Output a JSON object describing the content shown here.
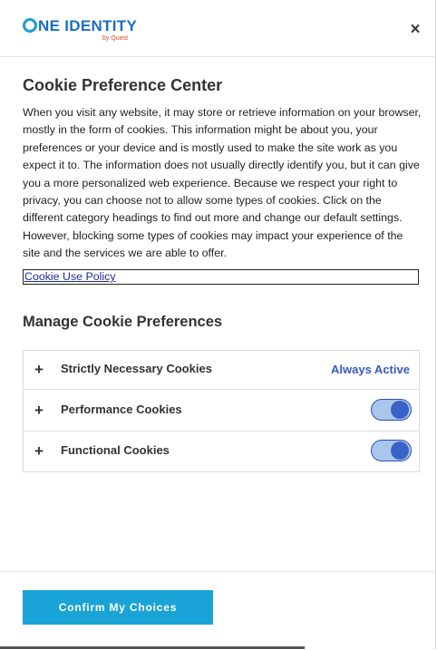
{
  "header": {
    "logo_main": "NE IDENTITY",
    "logo_sub": "by Quest",
    "close_label": "×"
  },
  "main": {
    "title": "Cookie Preference Center",
    "description": "When you visit any website, it may store or retrieve information on your browser, mostly in the form of cookies. This information might be about you, your preferences or your device and is mostly used to make the site work as you expect it to. The information does not usually directly identify you, but it can give you a more personalized web experience. Because we respect your right to privacy, you can choose not to allow some types of cookies. Click on the different category headings to find out more and change our default settings. However, blocking some types of cookies may impact your experience of the site and the services we are able to offer.",
    "policy_link": "Cookie Use Policy",
    "manage_title": "Manage Cookie Preferences"
  },
  "preferences": [
    {
      "expand": "+",
      "label": "Strictly Necessary Cookies",
      "status": "Always Active"
    },
    {
      "expand": "+",
      "label": "Performance Cookies",
      "toggle_on": true
    },
    {
      "expand": "+",
      "label": "Functional Cookies",
      "toggle_on": true
    }
  ],
  "footer": {
    "confirm_label": "Confirm My Choices"
  },
  "colors": {
    "brand_blue": "#1b6fbf",
    "button_bg": "#1aa3d6",
    "toggle_on": "#3a62c7",
    "link": "#1e2a9a"
  }
}
